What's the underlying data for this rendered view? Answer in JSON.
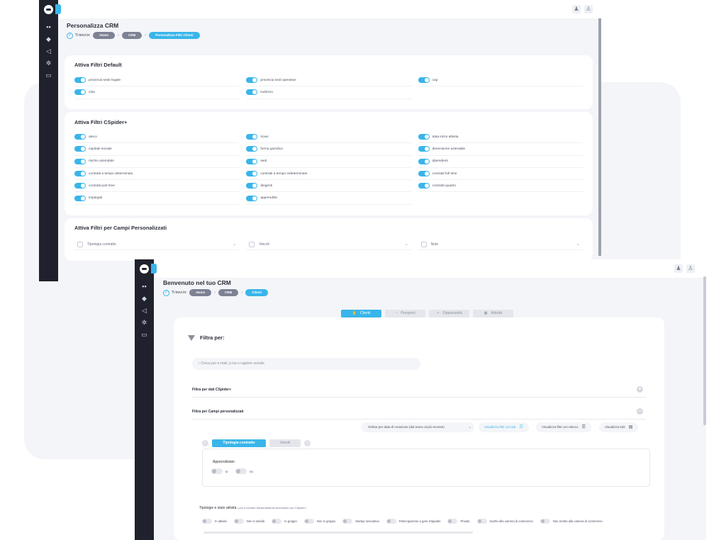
{
  "back": {
    "breadcrumb_label": "Ti trovi in:",
    "breadcrumb": [
      "Home",
      "CRM",
      "Personalizza Filtri Clienti"
    ],
    "title": "Personalizza CRM",
    "section_default": {
      "title": "Attiva Filtri Default",
      "items": [
        "provincia sede legale",
        "provincia sedi operative",
        "cap",
        "citta",
        "indirizzo"
      ]
    },
    "section_cspider": {
      "title": "Attiva Filtri CSpider+",
      "items": [
        "ateco",
        "ricavi",
        "data inizio attivita",
        "capitale sociale",
        "forma giuridica",
        "dimensione aziendale",
        "rischio aziendale",
        "sedi",
        "dipendenti",
        "contratti a tempo determinato",
        "contratti a tempo indeterminato",
        "contratti full time",
        "contratti part time",
        "dirigenti",
        "contratti quadro",
        "impiegati",
        "apprendisti"
      ]
    },
    "section_custom": {
      "title": "Attiva Filtri per Campi Personalizzati",
      "fields": [
        "Tipologia contratto",
        "Veicoli",
        "Note"
      ]
    }
  },
  "front": {
    "title": "Benvenuto nel tuo CRM",
    "breadcrumb_label": "Ti trovi in:",
    "breadcrumb": [
      "Home",
      "CRM",
      "Clienti"
    ],
    "tabs": [
      {
        "label": "Clienti",
        "icon": "handshake-icon",
        "glyph": "✋"
      },
      {
        "label": "Prospect",
        "icon": "pie-chart-icon",
        "glyph": "◔"
      },
      {
        "label": "Opportunità",
        "icon": "trend-icon",
        "glyph": "↗"
      },
      {
        "label": "Attività",
        "icon": "calendar-icon",
        "glyph": "▦"
      }
    ],
    "filter_title": "Filtra per:",
    "search_placeholder": "Cerca per e-mail, p.iva o ragione sociale",
    "acc_cspider": "Filtra per dati CSpider+",
    "acc_custom": "Filtra per Campi personalizzati",
    "order_label": "Ordina per data di creazione (dal meno al più recente)",
    "view_buttons": [
      "Visualizza filtri con tab",
      "Visualizza filtri con elenco",
      "Visualizza tutti"
    ],
    "subtabs": [
      "Tipologia contratto",
      "Veicoli"
    ],
    "field_label": "Apprendistato",
    "options": [
      "si",
      "no"
    ],
    "tipologie_title": "Tipologie e stato attività",
    "tipologie_note": "• per il corretto funzionamento arricchisci con CSpider+",
    "tipologie": [
      "In attività",
      "Non in attività",
      "In gruppo",
      "Non in gruppo",
      "Startup innovativa",
      "Partecipazione a gare d'appalto",
      "Privato",
      "Iscritto alla camera di commercio",
      "Non iscritto alla camera di commercio"
    ]
  },
  "colors": {
    "accent": "#39b5ea",
    "sidebar": "#1f222c",
    "pill": "#7d8294"
  }
}
